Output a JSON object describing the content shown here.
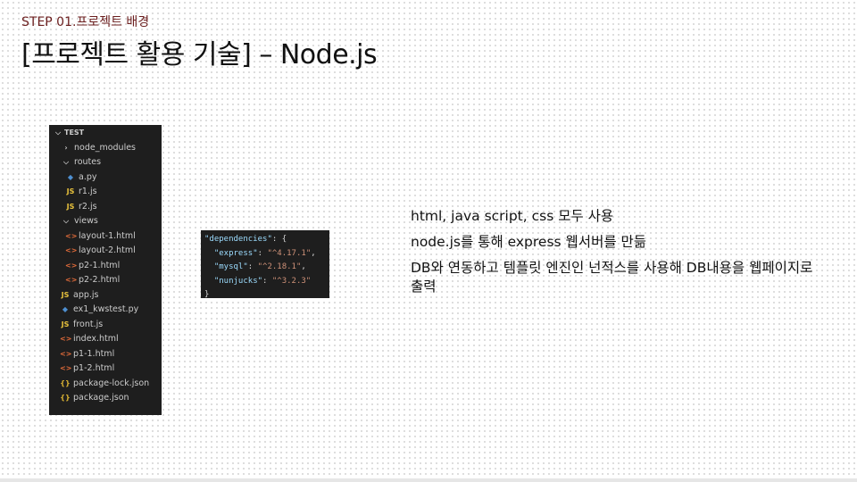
{
  "header": {
    "step_label": "STEP 01.프로젝트 배경",
    "title": "[프로젝트 활용 기술] – Node.js"
  },
  "explorer": {
    "items": [
      {
        "label": "TEST",
        "icon": "chevron-down-icon"
      },
      {
        "label": "node_modules",
        "icon": "chevron-right-icon"
      },
      {
        "label": "routes",
        "icon": "chevron-down-icon"
      },
      {
        "label": "a.py",
        "icon": "python-file-icon"
      },
      {
        "label": "r1.js",
        "icon": "javascript-file-icon"
      },
      {
        "label": "r2.js",
        "icon": "javascript-file-icon"
      },
      {
        "label": "views",
        "icon": "chevron-down-icon"
      },
      {
        "label": "layout-1.html",
        "icon": "html-file-icon"
      },
      {
        "label": "layout-2.html",
        "icon": "html-file-icon"
      },
      {
        "label": "p2-1.html",
        "icon": "html-file-icon"
      },
      {
        "label": "p2-2.html",
        "icon": "html-file-icon"
      },
      {
        "label": "app.js",
        "icon": "javascript-file-icon"
      },
      {
        "label": "ex1_kwstest.py",
        "icon": "python-file-icon"
      },
      {
        "label": "front.js",
        "icon": "javascript-file-icon"
      },
      {
        "label": "index.html",
        "icon": "html-file-icon"
      },
      {
        "label": "p1-1.html",
        "icon": "html-file-icon"
      },
      {
        "label": "p1-2.html",
        "icon": "html-file-icon"
      },
      {
        "label": "package-lock.json",
        "icon": "json-file-icon"
      },
      {
        "label": "package.json",
        "icon": "json-file-icon"
      }
    ]
  },
  "code": {
    "key_root": "\"dependencies\"",
    "open": ": {",
    "deps": [
      {
        "key": "\"express\"",
        "value": "\"^4.17.1\"",
        "comma": ","
      },
      {
        "key": "\"mysql\"",
        "value": "\"^2.18.1\"",
        "comma": ","
      },
      {
        "key": "\"nunjucks\"",
        "value": "\"^3.2.3\"",
        "comma": ""
      }
    ],
    "close": "}"
  },
  "bullets": [
    "html, java script, css 모두 사용",
    "node.js를 통해 express 웹서버를 만듦",
    "DB와 연동하고 템플릿 엔진인 넌적스를 사용해 DB내용을 웹페이지로 출력"
  ],
  "colors": {
    "step_label": "#6b1e1e",
    "editor_bg": "#1e1e1e",
    "json_key": "#9cdcfe",
    "json_string": "#ce9178"
  }
}
